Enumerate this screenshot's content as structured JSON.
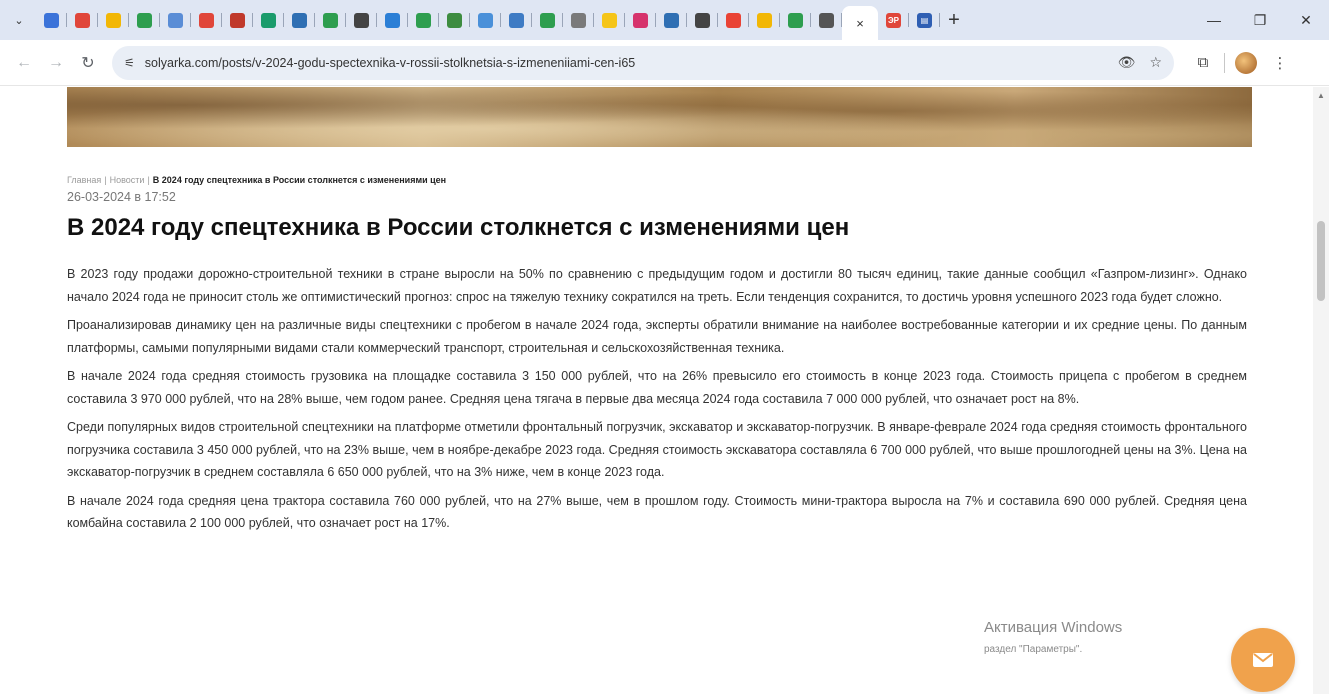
{
  "browser": {
    "tab_favicons": [
      {
        "name": "tab-1",
        "color": "#3b73d9"
      },
      {
        "name": "tab-2",
        "color": "#e0463a"
      },
      {
        "name": "tab-3",
        "color": "#f2b705"
      },
      {
        "name": "tab-4",
        "color": "#2e9e4f"
      },
      {
        "name": "tab-5",
        "color": "#5a8dd6"
      },
      {
        "name": "tab-6",
        "color": "#e0463a"
      },
      {
        "name": "tab-7",
        "color": "#c0392b"
      },
      {
        "name": "tab-8",
        "color": "#1a9b6b"
      },
      {
        "name": "tab-9",
        "color": "#2f6fb3"
      },
      {
        "name": "tab-10",
        "color": "#2e9e4f"
      },
      {
        "name": "tab-11",
        "color": "#444444"
      },
      {
        "name": "tab-12",
        "color": "#2b7fd6"
      },
      {
        "name": "tab-13",
        "color": "#2e9e4f"
      },
      {
        "name": "tab-14",
        "color": "#3d8c40"
      },
      {
        "name": "tab-15",
        "color": "#4a90d9"
      },
      {
        "name": "tab-16",
        "color": "#3e7bc4"
      },
      {
        "name": "tab-17",
        "color": "#2e9e4f"
      },
      {
        "name": "tab-18",
        "color": "#7a7a7a"
      },
      {
        "name": "tab-19",
        "color": "#f5c518"
      },
      {
        "name": "tab-20",
        "color": "#d6336c"
      },
      {
        "name": "tab-21",
        "color": "#2f6fb3"
      },
      {
        "name": "tab-22",
        "color": "#444444"
      },
      {
        "name": "tab-23",
        "color": "#e94335"
      },
      {
        "name": "tab-24",
        "color": "#f2b705"
      },
      {
        "name": "tab-25",
        "color": "#2e9e4f"
      },
      {
        "name": "tab-26",
        "color": "#555555"
      }
    ],
    "active_tab_close": "×",
    "extra_tabs": [
      {
        "label": "ЭР",
        "color": "#e0463a"
      },
      {
        "label": "▤",
        "color": "#2f5fb3"
      }
    ],
    "new_tab": "+",
    "url": "solyarka.com/posts/v-2024-godu-spectexnika-v-rossii-stolknetsia-s-izmeneniiami-cen-i65"
  },
  "breadcrumb": {
    "home": "Главная",
    "news": "Новости",
    "current": "В 2024 году спецтехника в России столкнется с изменениями цен"
  },
  "post_date": "26-03-2024 в 17:52",
  "title": "В 2024 году спецтехника в России столкнется с изменениями цен",
  "paragraphs": [
    "В 2023 году продажи дорожно-строительной техники в стране выросли на 50% по сравнению с предыдущим годом и достигли 80 тысяч единиц, такие данные сообщил «Газпром-лизинг». Однако начало 2024 года не приносит столь же оптимистический прогноз: спрос на тяжелую технику сократился на треть. Если тенденция сохранится, то достичь уровня успешного 2023 года будет сложно.",
    "Проанализировав динамику цен на различные виды спецтехники с пробегом в начале 2024 года, эксперты обратили внимание на наиболее востребованные категории и их средние цены. По данным платформы, самыми популярными видами стали коммерческий транспорт, строительная и сельскохозяйственная техника.",
    "В начале 2024 года средняя стоимость грузовика на площадке составила 3 150 000 рублей, что на 26% превысило его стоимость в конце 2023 года. Стоимость прицепа с пробегом в среднем составила 3 970 000 рублей, что на 28% выше, чем годом ранее. Средняя цена тягача в первые два месяца 2024 года составила 7 000 000 рублей, что означает рост на 8%.",
    "Среди популярных видов строительной спецтехники на платформе отметили фронтальный погрузчик, экскаватор и экскаватор-погрузчик. В январе-феврале 2024 года средняя стоимость фронтального погрузчика составила 3 450 000 рублей, что на 23% выше, чем в ноябре-декабре 2023 года. Средняя стоимость экскаватора составляла 6 700 000 рублей, что выше прошлогодней цены на 3%. Цена на экскаватор-погрузчик в среднем составляла 6 650 000 рублей, что на 3% ниже, чем в конце 2023 года.",
    "В начале 2024 года средняя цена трактора составила 760 000 рублей, что на 27% выше, чем в прошлом году. Стоимость мини-трактора выросла на 7% и составила 690 000 рублей. Средняя цена комбайна составила 2 100 000 рублей, что означает рост на 17%."
  ],
  "windows_activation": {
    "line1": "Активация Windows",
    "line2": "раздел \"Параметры\"."
  },
  "colors": {
    "accent_fab": "#f0a24c",
    "tabstrip_bg": "#dfe6f3",
    "omnibox_bg": "#e9eef6"
  }
}
